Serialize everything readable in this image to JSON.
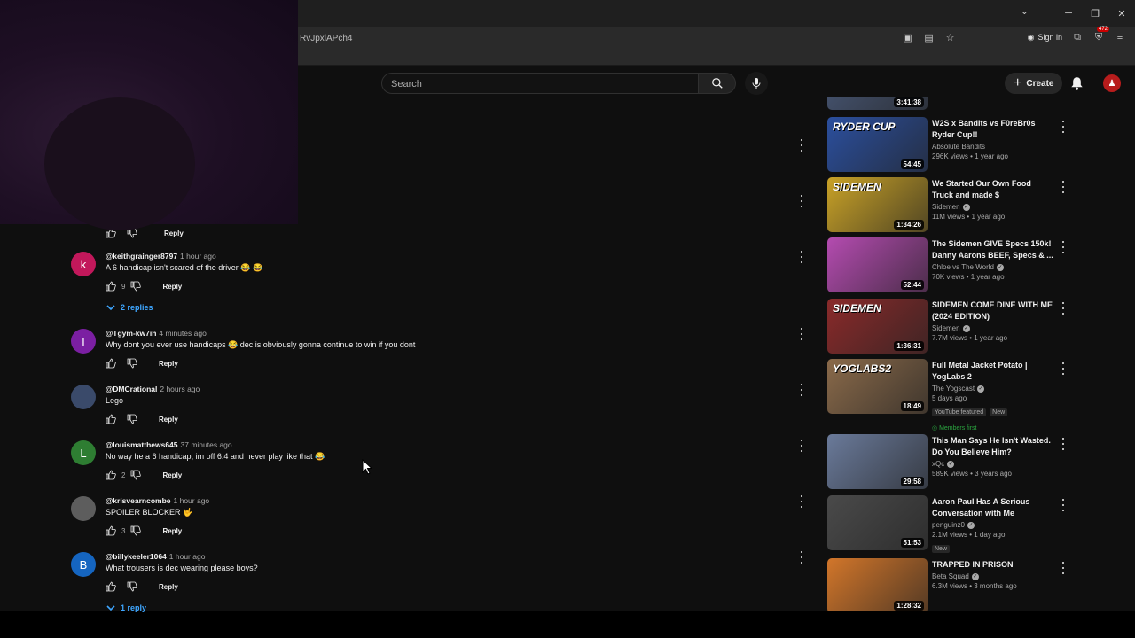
{
  "browser": {
    "url": "RvJpxlAPch4",
    "sign_in": "Sign in",
    "ext_badge": "472"
  },
  "header": {
    "search_placeholder": "Search",
    "create_label": "Create"
  },
  "comments": [
    {
      "author": "@keithgrainger8797",
      "time": "1 hour ago",
      "text": "A 6 handicap isn't scared of the driver 😂 😂",
      "likes": "9",
      "avatar_letter": "k",
      "avatar_color": "#c2185b",
      "replies": "2 replies"
    },
    {
      "author": "@Tgym-kw7ih",
      "time": "4 minutes ago",
      "text": "Why dont you ever use handicaps 😂 dec is obviously gonna continue to win if you dont",
      "likes": "",
      "avatar_letter": "T",
      "avatar_color": "#7b1fa2"
    },
    {
      "author": "@DMCrational",
      "time": "2 hours ago",
      "text": "Lego",
      "likes": "",
      "avatar_letter": "",
      "avatar_color": "#3a4a6a"
    },
    {
      "author": "@louismatthews645",
      "time": "37 minutes ago",
      "text": "No way he a 6 handicap, im off 6.4 and never play like that 😂",
      "likes": "2",
      "avatar_letter": "L",
      "avatar_color": "#2e7d32"
    },
    {
      "author": "@krisvearncombe",
      "time": "1 hour ago",
      "text": "SPOILER BLOCKER 🤟",
      "likes": "3",
      "avatar_letter": "",
      "avatar_color": "#5d5d5d"
    },
    {
      "author": "@billykeeler1064",
      "time": "1 hour ago",
      "text": "What trousers is dec wearing please boys?",
      "likes": "",
      "avatar_letter": "B",
      "avatar_color": "#1565c0",
      "replies": "1 reply"
    }
  ],
  "reply_label": "Reply",
  "recommendations": [
    {
      "title": "",
      "channel": "",
      "meta": "",
      "duration": "3:41:38",
      "thumb_color": "#4a5a7a"
    },
    {
      "title": "W2S x Bandits vs F0reBr0s Ryder Cup!!",
      "channel": "Absolute Bandits",
      "verified": false,
      "meta": "296K views • 1 year ago",
      "duration": "54:45",
      "thumb_color": "#2b4f9e",
      "overlay": "RYDER CUP"
    },
    {
      "title": "We Started Our Own Food Truck and made $____",
      "channel": "Sidemen",
      "verified": true,
      "meta": "11M views • 1 year ago",
      "duration": "1:34:26",
      "thumb_color": "#c9a227",
      "overlay": "SIDEMEN"
    },
    {
      "title": "The Sidemen GIVE Specs 150k! Danny Aarons BEEF, Specs & ...",
      "channel": "Chloe vs The World",
      "verified": true,
      "meta": "70K views • 1 year ago",
      "duration": "52:44",
      "thumb_color": "#b44bb0"
    },
    {
      "title": "SIDEMEN COME DINE WITH ME (2024 EDITION)",
      "channel": "Sidemen",
      "verified": true,
      "meta": "7.7M views • 1 year ago",
      "duration": "1:36:31",
      "thumb_color": "#8a2a2a",
      "overlay": "SIDEMEN"
    },
    {
      "title": "Full Metal Jacket Potato | YogLabs 2",
      "channel": "The Yogscast",
      "verified": true,
      "meta": "5 days ago",
      "duration": "18:49",
      "thumb_color": "#8a6a4a",
      "overlay": "YOGLABS2",
      "pills": [
        "YouTube featured",
        "New"
      ],
      "members": "Members first"
    },
    {
      "title": "This Man Says He Isn't Wasted. Do You Believe Him?",
      "channel": "xQc",
      "verified": true,
      "meta": "589K views • 3 years ago",
      "duration": "29:58",
      "thumb_color": "#6a7a9a"
    },
    {
      "title": "Aaron Paul Has A Serious Conversation with Me",
      "channel": "penguinz0",
      "verified": true,
      "meta": "2.1M views • 1 day ago",
      "duration": "51:53",
      "thumb_color": "#4a4a4a",
      "pills": [
        "New"
      ]
    },
    {
      "title": "TRAPPED IN PRISON",
      "channel": "Beta Squad",
      "verified": true,
      "meta": "6.3M views • 3 months ago",
      "duration": "1:28:32",
      "thumb_color": "#d2762a"
    }
  ]
}
